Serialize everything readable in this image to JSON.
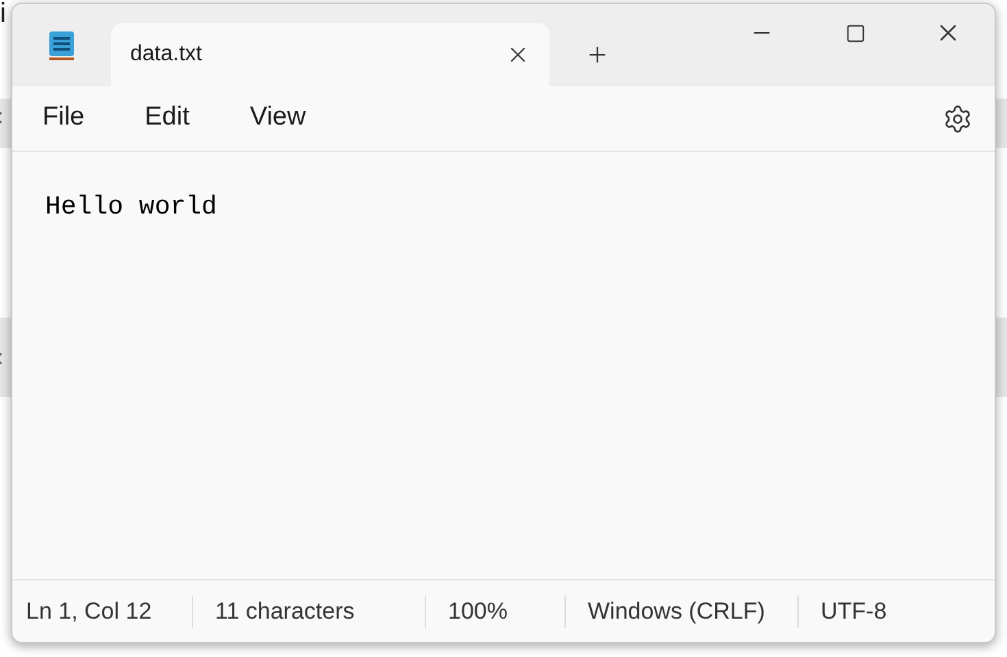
{
  "background": {
    "texts": [
      "i"
    ]
  },
  "window": {
    "tabs": [
      {
        "title": "data.txt",
        "selected": true
      }
    ]
  },
  "menu": [
    "File",
    "Edit",
    "View"
  ],
  "editor": {
    "value": "Hello world"
  },
  "status_bar": [
    "Ln 1, Col 12",
    "11 characters",
    "100%",
    "Windows (CRLF)",
    "UTF-8"
  ]
}
